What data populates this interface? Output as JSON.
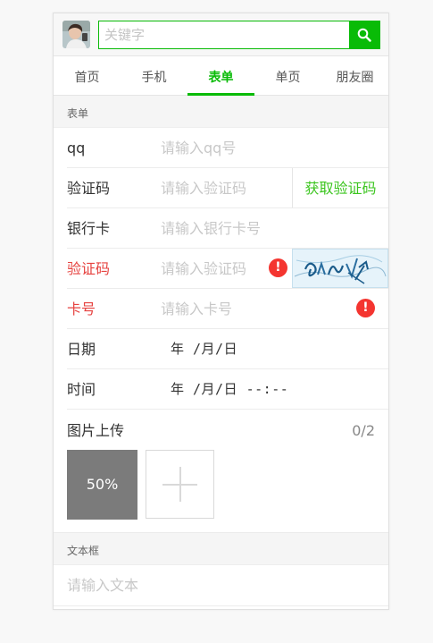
{
  "search": {
    "placeholder": "关键字"
  },
  "tabs": [
    {
      "label": "首页",
      "active": false
    },
    {
      "label": "手机",
      "active": false
    },
    {
      "label": "表单",
      "active": true
    },
    {
      "label": "单页",
      "active": false
    },
    {
      "label": "朋友圈",
      "active": false
    }
  ],
  "form": {
    "section_title": "表单",
    "qq": {
      "label": "qq",
      "placeholder": "请输入qq号"
    },
    "code": {
      "label": "验证码",
      "placeholder": "请输入验证码",
      "button": "获取验证码"
    },
    "bank": {
      "label": "银行卡",
      "placeholder": "请输入银行卡号"
    },
    "captcha": {
      "label": "验证码",
      "placeholder": "请输入验证码",
      "warn": "!"
    },
    "card": {
      "label": "卡号",
      "placeholder": "请输入卡号",
      "warn": "!"
    },
    "date": {
      "label": "日期",
      "value": "年 /月/日"
    },
    "time": {
      "label": "时间",
      "value": "年 /月/日 --:--"
    }
  },
  "upload": {
    "label": "图片上传",
    "count": "0/2",
    "progress": "50%"
  },
  "textarea_section": {
    "title": "文本框",
    "placeholder": "请输入文本"
  },
  "colors": {
    "accent": "#09bb07",
    "error": "#e64340",
    "warn_icon": "#f43530"
  }
}
